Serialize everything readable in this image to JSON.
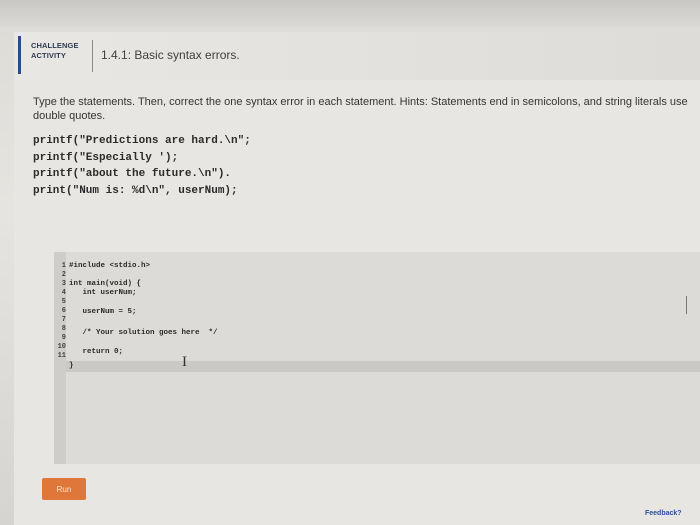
{
  "header": {
    "activity_label_line1": "CHALLENGE",
    "activity_label_line2": "ACTIVITY",
    "title": "1.4.1: Basic syntax errors."
  },
  "instructions": "Type the statements. Then, correct the one syntax error in each statement. Hints: Statements end in semicolons, and string literals use double quotes.",
  "sample_statements": [
    "printf(\"Predictions are hard.\\n\";",
    "printf(\"Especially ');",
    "printf(\"about the future.\\n\").",
    "print(\"Num is: %d\\n\", userNum);"
  ],
  "editor": {
    "line_numbers": [
      "1",
      "2",
      "3",
      "4",
      "5",
      "6",
      "7",
      "8",
      "9",
      "10",
      "11"
    ],
    "lines": [
      "#include <stdio.h>",
      "",
      "int main(void) {",
      "   int userNum;",
      "",
      "   userNum = 5;",
      "",
      "   /* Your solution goes here  */",
      "",
      "   return 0;",
      "}"
    ]
  },
  "run_label": "Run",
  "feedback_label": "Feedback?",
  "colors": {
    "accent": "#2c4a86",
    "run_button": "#e0773a",
    "link": "#2b4f9c"
  }
}
